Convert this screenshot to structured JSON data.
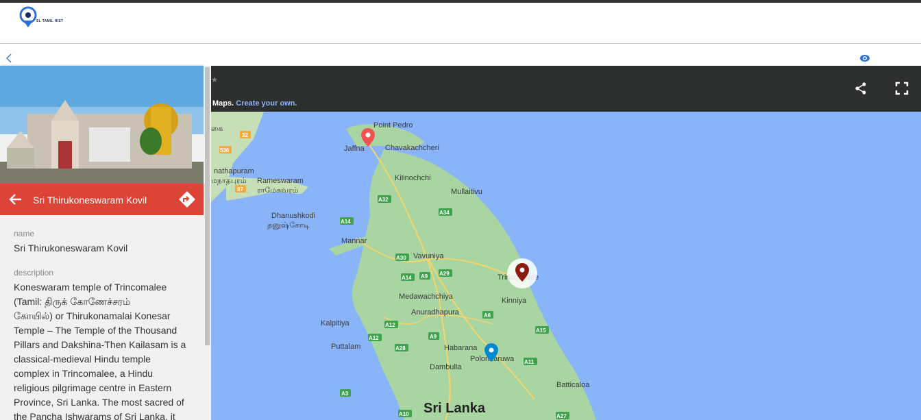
{
  "site": {
    "logo_text": "SL TAMIL HIST"
  },
  "map": {
    "credit_prefix": "Maps.",
    "credit_link": "Create your own.",
    "places": [
      "Point Pedro",
      "Jaffna",
      "Chavakachcheri",
      "Kilinochchi",
      "Mullaitivu",
      "Rameswaram",
      "ராமேசுவரம்",
      "nathapuram",
      "மநாதபுரம்",
      "Dhanushkodi",
      "தனுஷ்கோடி",
      "Mannar",
      "Vavuniya",
      "Trincomalee",
      "Kinniya",
      "Medawachchiya",
      "Anuradhapura",
      "Kalpitiya",
      "Puttalam",
      "Habarana",
      "Polonnaruwa",
      "Dambulla",
      "Batticaloa",
      "கை"
    ],
    "region_label": "Sri Lanka",
    "roads": [
      "32",
      "536",
      "87",
      "A32",
      "A34",
      "A14",
      "A30",
      "A14",
      "A9",
      "A29",
      "A6",
      "A12",
      "A12",
      "A9",
      "A28",
      "A15",
      "A11",
      "A3",
      "A10",
      "A27"
    ]
  },
  "panel": {
    "title": "Sri Thirukoneswaram Kovil",
    "name_label": "name",
    "name_value": "Sri Thirukoneswaram Kovil",
    "desc_label": "description",
    "desc_lines": [
      "Koneswaram temple of Trincomalee",
      "(Tamil: திருக் கோணேச்சரம்",
      "கோயில்) or Thirukonamalai Konesar",
      "Temple – The Temple of the Thousand",
      "Pillars and Dakshina-Then Kailasam is a",
      "classical-medieval Hindu temple",
      "complex in Trincomalee, a Hindu",
      "religious pilgrimage centre in Eastern",
      "Province, Sri Lanka. The most sacred of",
      "the Pancha Ishwarams of Sri Lanka, it"
    ]
  },
  "colors": {
    "title_bar": "#db4437",
    "map_water": "#8ab4f8",
    "land": "#a8d5a2",
    "header": "#2d2f2e"
  },
  "icons": [
    "back-chevron-icon",
    "eye-icon",
    "share-icon",
    "fullscreen-icon",
    "arrow-back-icon",
    "directions-icon",
    "map-pin-icon"
  ]
}
